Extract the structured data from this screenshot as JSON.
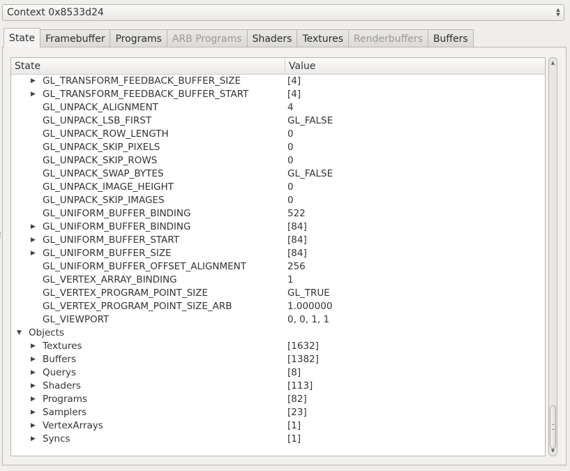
{
  "context_selector": {
    "label": "Context 0x8533d24"
  },
  "tabs": [
    {
      "label": "State",
      "active": true,
      "enabled": true
    },
    {
      "label": "Framebuffer",
      "active": false,
      "enabled": true
    },
    {
      "label": "Programs",
      "active": false,
      "enabled": true
    },
    {
      "label": "ARB Programs",
      "active": false,
      "enabled": false
    },
    {
      "label": "Shaders",
      "active": false,
      "enabled": true
    },
    {
      "label": "Textures",
      "active": false,
      "enabled": true
    },
    {
      "label": "Renderbuffers",
      "active": false,
      "enabled": false
    },
    {
      "label": "Buffers",
      "active": false,
      "enabled": true
    }
  ],
  "tree": {
    "columns": {
      "state": "State",
      "value": "Value"
    },
    "rows": [
      {
        "name": "GL_TRANSFORM_FEEDBACK_BUFFER_SIZE",
        "value": "[4]",
        "level": 1,
        "expander": "collapsed"
      },
      {
        "name": "GL_TRANSFORM_FEEDBACK_BUFFER_START",
        "value": "[4]",
        "level": 1,
        "expander": "collapsed"
      },
      {
        "name": "GL_UNPACK_ALIGNMENT",
        "value": "4",
        "level": 1,
        "expander": "none"
      },
      {
        "name": "GL_UNPACK_LSB_FIRST",
        "value": "GL_FALSE",
        "level": 1,
        "expander": "none"
      },
      {
        "name": "GL_UNPACK_ROW_LENGTH",
        "value": "0",
        "level": 1,
        "expander": "none"
      },
      {
        "name": "GL_UNPACK_SKIP_PIXELS",
        "value": "0",
        "level": 1,
        "expander": "none"
      },
      {
        "name": "GL_UNPACK_SKIP_ROWS",
        "value": "0",
        "level": 1,
        "expander": "none"
      },
      {
        "name": "GL_UNPACK_SWAP_BYTES",
        "value": "GL_FALSE",
        "level": 1,
        "expander": "none"
      },
      {
        "name": "GL_UNPACK_IMAGE_HEIGHT",
        "value": "0",
        "level": 1,
        "expander": "none"
      },
      {
        "name": "GL_UNPACK_SKIP_IMAGES",
        "value": "0",
        "level": 1,
        "expander": "none"
      },
      {
        "name": "GL_UNIFORM_BUFFER_BINDING",
        "value": "522",
        "level": 1,
        "expander": "none"
      },
      {
        "name": "GL_UNIFORM_BUFFER_BINDING",
        "value": "[84]",
        "level": 1,
        "expander": "collapsed"
      },
      {
        "name": "GL_UNIFORM_BUFFER_START",
        "value": "[84]",
        "level": 1,
        "expander": "collapsed"
      },
      {
        "name": "GL_UNIFORM_BUFFER_SIZE",
        "value": "[84]",
        "level": 1,
        "expander": "collapsed"
      },
      {
        "name": "GL_UNIFORM_BUFFER_OFFSET_ALIGNMENT",
        "value": "256",
        "level": 1,
        "expander": "none"
      },
      {
        "name": "GL_VERTEX_ARRAY_BINDING",
        "value": "1",
        "level": 1,
        "expander": "none"
      },
      {
        "name": "GL_VERTEX_PROGRAM_POINT_SIZE",
        "value": "GL_TRUE",
        "level": 1,
        "expander": "none"
      },
      {
        "name": "GL_VERTEX_PROGRAM_POINT_SIZE_ARB",
        "value": "1.000000",
        "level": 1,
        "expander": "none"
      },
      {
        "name": "GL_VIEWPORT",
        "value": "0, 0, 1, 1",
        "level": 1,
        "expander": "none"
      },
      {
        "name": "Objects",
        "value": "",
        "level": 0,
        "expander": "expanded"
      },
      {
        "name": "Textures",
        "value": "[1632]",
        "level": 1,
        "expander": "collapsed"
      },
      {
        "name": "Buffers",
        "value": "[1382]",
        "level": 1,
        "expander": "collapsed"
      },
      {
        "name": "Querys",
        "value": "[8]",
        "level": 1,
        "expander": "collapsed"
      },
      {
        "name": "Shaders",
        "value": "[113]",
        "level": 1,
        "expander": "collapsed"
      },
      {
        "name": "Programs",
        "value": "[82]",
        "level": 1,
        "expander": "collapsed"
      },
      {
        "name": "Samplers",
        "value": "[23]",
        "level": 1,
        "expander": "collapsed"
      },
      {
        "name": "VertexArrays",
        "value": "[1]",
        "level": 1,
        "expander": "collapsed"
      },
      {
        "name": "Syncs",
        "value": "[1]",
        "level": 1,
        "expander": "collapsed"
      }
    ]
  },
  "scrollbar": {
    "position_fraction": 0.97
  },
  "icons": {
    "collapsed": "triangle-right",
    "expanded": "triangle-down",
    "combo": "up-down-arrows"
  }
}
